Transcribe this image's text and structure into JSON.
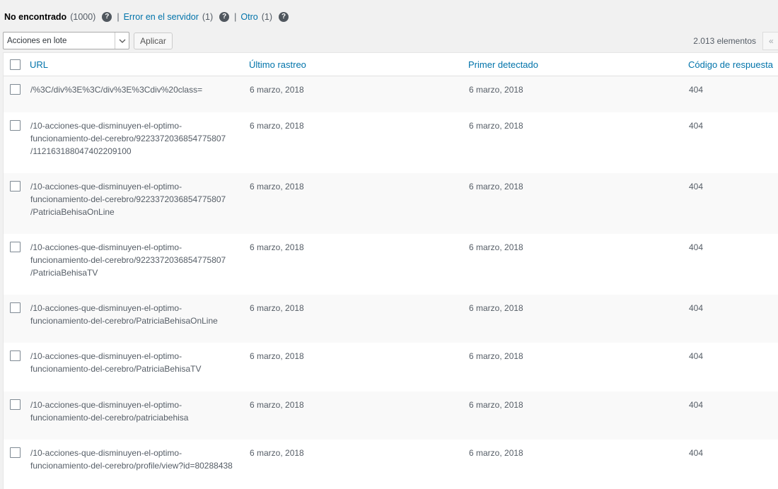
{
  "filters": {
    "not_found_label": "No encontrado",
    "not_found_count": "(1000)",
    "server_error_label": "Error en el servidor",
    "server_error_count": "(1)",
    "other_label": "Otro",
    "other_count": "(1)",
    "separator": "|"
  },
  "tablenav": {
    "bulk_actions": "Acciones en lote",
    "apply": "Aplicar",
    "displaying": "2.013 elementos",
    "first_page": "«"
  },
  "columns": {
    "url": "URL",
    "last_crawled": "Último rastreo",
    "first_detected": "Primer detectado",
    "response_code": "Código de respuesta"
  },
  "rows": [
    {
      "url": "/%3C/div%3E%3C/div%3E%3Cdiv%20class=",
      "last": "6 marzo, 2018",
      "first": "6 marzo, 2018",
      "code": "404"
    },
    {
      "url": "/10-acciones-que-disminuyen-el-optimo-\nfuncionamiento-del-cerebro/9223372036854775807\n/112163188047402209100",
      "last": "6 marzo, 2018",
      "first": "6 marzo, 2018",
      "code": "404"
    },
    {
      "url": "/10-acciones-que-disminuyen-el-optimo-\nfuncionamiento-del-cerebro/9223372036854775807\n/PatriciaBehisaOnLine",
      "last": "6 marzo, 2018",
      "first": "6 marzo, 2018",
      "code": "404"
    },
    {
      "url": "/10-acciones-que-disminuyen-el-optimo-\nfuncionamiento-del-cerebro/9223372036854775807\n/PatriciaBehisaTV",
      "last": "6 marzo, 2018",
      "first": "6 marzo, 2018",
      "code": "404"
    },
    {
      "url": "/10-acciones-que-disminuyen-el-optimo-\nfuncionamiento-del-cerebro/PatriciaBehisaOnLine",
      "last": "6 marzo, 2018",
      "first": "6 marzo, 2018",
      "code": "404"
    },
    {
      "url": "/10-acciones-que-disminuyen-el-optimo-\nfuncionamiento-del-cerebro/PatriciaBehisaTV",
      "last": "6 marzo, 2018",
      "first": "6 marzo, 2018",
      "code": "404"
    },
    {
      "url": "/10-acciones-que-disminuyen-el-optimo-\nfuncionamiento-del-cerebro/patriciabehisa",
      "last": "6 marzo, 2018",
      "first": "6 marzo, 2018",
      "code": "404"
    },
    {
      "url": "/10-acciones-que-disminuyen-el-optimo-\nfuncionamiento-del-cerebro/profile/view?id=80288438",
      "last": "6 marzo, 2018",
      "first": "6 marzo, 2018",
      "code": "404"
    }
  ],
  "colors": {
    "link": "#0073aa",
    "alt_row": "#f9f9f9",
    "background": "#f1f1f1"
  },
  "icons": {
    "help": "question-circle-icon",
    "dropdown": "chevron-down-icon"
  }
}
